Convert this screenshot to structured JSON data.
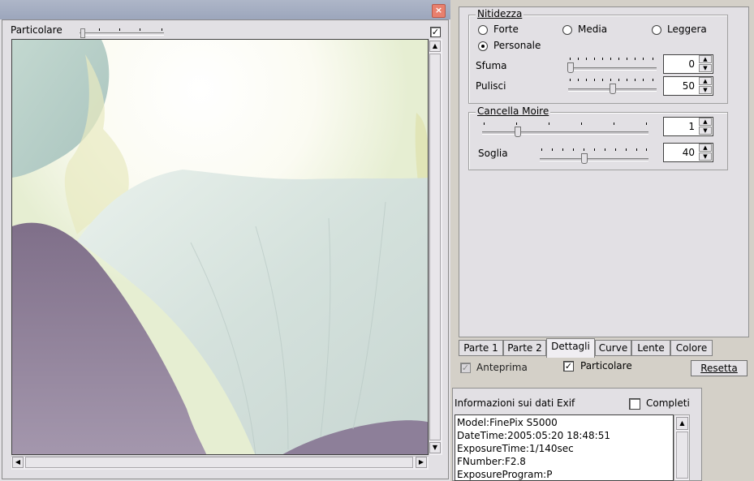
{
  "preview": {
    "detail_label": "Particolare",
    "detail_checked": true
  },
  "sharpness": {
    "title": "Nitidezza",
    "options": [
      "Forte",
      "Media",
      "Leggera",
      "Personale"
    ],
    "selected": "Personale",
    "blur_label": "Sfuma",
    "blur_value": "0",
    "clean_label": "Pulisci",
    "clean_value": "50"
  },
  "moire": {
    "title": "Cancella Moire",
    "value": "1",
    "threshold_label": "Soglia",
    "threshold_value": "40"
  },
  "tabs": [
    "Parte 1",
    "Parte 2",
    "Dettagli",
    "Curve",
    "Lente",
    "Colore"
  ],
  "active_tab": "Dettagli",
  "bottom": {
    "preview_label": "Anteprima",
    "preview_checked": true,
    "detail_label": "Particolare",
    "detail_checked": true,
    "reset_label": "Resetta"
  },
  "exif": {
    "title": "Informazioni sui dati Exif",
    "complete_label": "Completi",
    "complete_checked": false,
    "lines": [
      "Model:FinePix S5000",
      "DateTime:2005:05:20 18:48:51",
      "ExposureTime:1/140sec",
      "FNumber:F2.8",
      "ExposureProgram:P"
    ]
  },
  "icons": {
    "close": "close-icon",
    "check": "check-icon",
    "arrow_up": "arrow-up-icon",
    "arrow_down": "arrow-down-icon",
    "arrow_left": "arrow-left-icon",
    "arrow_right": "arrow-right-icon"
  },
  "colors": {
    "window_bg": "#e2e0e4",
    "panel_bg": "#d4d0c8",
    "titlebar": "#a4adc2",
    "close": "#e8806e"
  }
}
